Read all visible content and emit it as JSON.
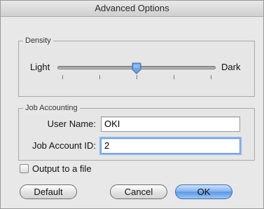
{
  "window": {
    "title": "Advanced Options"
  },
  "density": {
    "group_label": "Density",
    "min_label": "Light",
    "max_label": "Dark",
    "slider_value_fraction": 0.5,
    "tick_count": 5
  },
  "job_accounting": {
    "group_label": "Job Accounting",
    "user_name_label": "User Name:",
    "user_name_value": "OKI",
    "job_account_id_label": "Job Account ID:",
    "job_account_id_value": "2"
  },
  "output_to_file": {
    "label": "Output to a file",
    "checked": false
  },
  "buttons": {
    "default_label": "Default",
    "cancel_label": "Cancel",
    "ok_label": "OK"
  },
  "colors": {
    "accent": "#5b97e3",
    "slider_thumb": "#6fa3e6"
  }
}
